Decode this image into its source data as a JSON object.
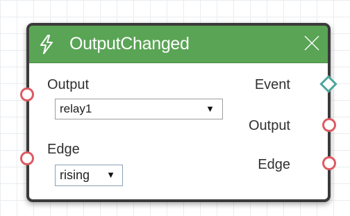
{
  "node": {
    "title": "OutputChanged",
    "icon": "lightning-bolt-icon",
    "close_icon": "close-icon"
  },
  "inputs": {
    "output": {
      "label": "Output",
      "value": "relay1"
    },
    "edge": {
      "label": "Edge",
      "value": "rising"
    }
  },
  "outputs": {
    "event": {
      "label": "Event"
    },
    "output": {
      "label": "Output"
    },
    "edge": {
      "label": "Edge"
    }
  },
  "colors": {
    "header": "#5aa455",
    "border": "#3a3a3a",
    "port_value": "#dd5a63",
    "port_event": "#4fa59b"
  }
}
